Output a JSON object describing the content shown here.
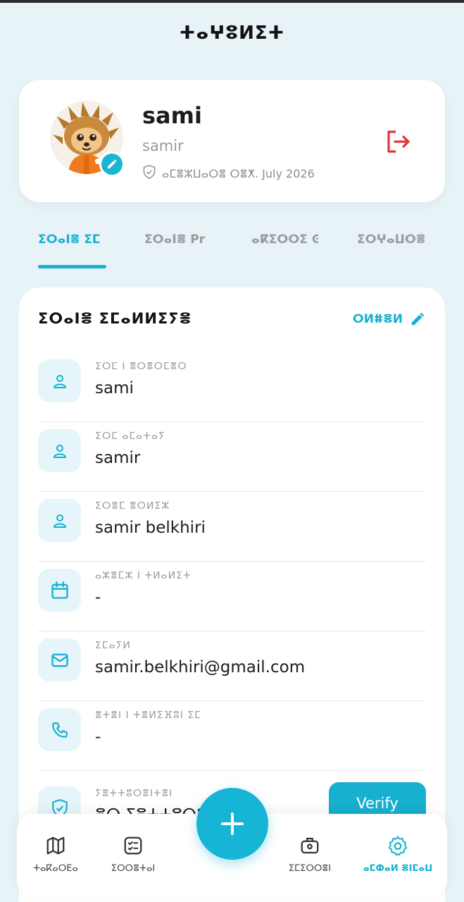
{
  "app": {
    "title": "ⵜⴰⵖⵓⵍⵉⵜ"
  },
  "profile": {
    "name": "sami",
    "username": "samir",
    "member_since": "ⴰⵎⴻⵣⵡⴰⵔⴻ ⵔⴻⵅ. July 2026"
  },
  "tabs": [
    {
      "label": "ⵉⵔⴰⵏⴻ ⵉⵎ",
      "active": true
    },
    {
      "label": "ⵉⵔⴰⵏⴻ Pr",
      "active": false
    },
    {
      "label": "ⴰⴽⵉⵔⵔⵉ ⵙ",
      "active": false
    },
    {
      "label": "ⵉⵔⵖⴰⵡⵔⴻ",
      "active": false
    }
  ],
  "info": {
    "title": "ⵉⵔⴰⵏⴻ ⵉⵎⴰⵍⵍⵉⵢⴻ",
    "edit_label": "ⵔⵍⵌⴻⵍ",
    "fields": [
      {
        "icon": "user-icon",
        "label": "ⵉⵔⵎ ⵏ ⴻⵔⴻⵔⵎⴻⵔ",
        "value": "sami"
      },
      {
        "icon": "user-icon",
        "label": "ⵉⵔⵎ ⴰⵎⴰⵜⴰⵢ",
        "value": "samir"
      },
      {
        "icon": "user-icon",
        "label": "ⵉⵔⴻⵎ ⴻⵔⵍⵉⵣ",
        "value": "samir belkhiri"
      },
      {
        "icon": "calendar-icon",
        "label": "ⴰⵣⴻⵎⵣ ⵏ ⵜⵍⴰⵍⵉⵜ",
        "value": "-"
      },
      {
        "icon": "mail-icon",
        "label": "ⵉⵎⴰⵢⵍ",
        "value": "samir.belkhiri@gmail.com"
      },
      {
        "icon": "phone-icon",
        "label": "ⴻⵜⴻⵏ ⵏ ⵜⴻⵍⵉⴼⵓⵏ ⵉⵎ",
        "value": "-"
      },
      {
        "icon": "shield-check-icon",
        "label": "ⵢⴻⵜⵜⵓⵔⴻⵏⵜⴻⵏ",
        "value": "ⴻⵔ ⵢⴻⵜⵜⵓⵔⴻ"
      }
    ],
    "verify_label": "Verify"
  },
  "nav": {
    "items": [
      {
        "icon": "map-icon",
        "label": "ⵜⴰⴽⴰⵔⴹⴰ",
        "active": false
      },
      {
        "icon": "checklist-icon",
        "label": "ⵉⵔⵔⴻⵜⴰⵏ",
        "active": false
      },
      {
        "icon": "briefcase-icon",
        "label": "ⵉⵎⵉⵔⵔⴻⵏ",
        "active": false
      },
      {
        "icon": "settings-icon",
        "label": "ⴰⵎⵀⴰⵍ ⴻⵏⵎⴰⵡ",
        "active": true
      }
    ]
  },
  "colors": {
    "accent": "#17b0cf",
    "danger": "#e0343a",
    "background": "#e7f3f7"
  }
}
